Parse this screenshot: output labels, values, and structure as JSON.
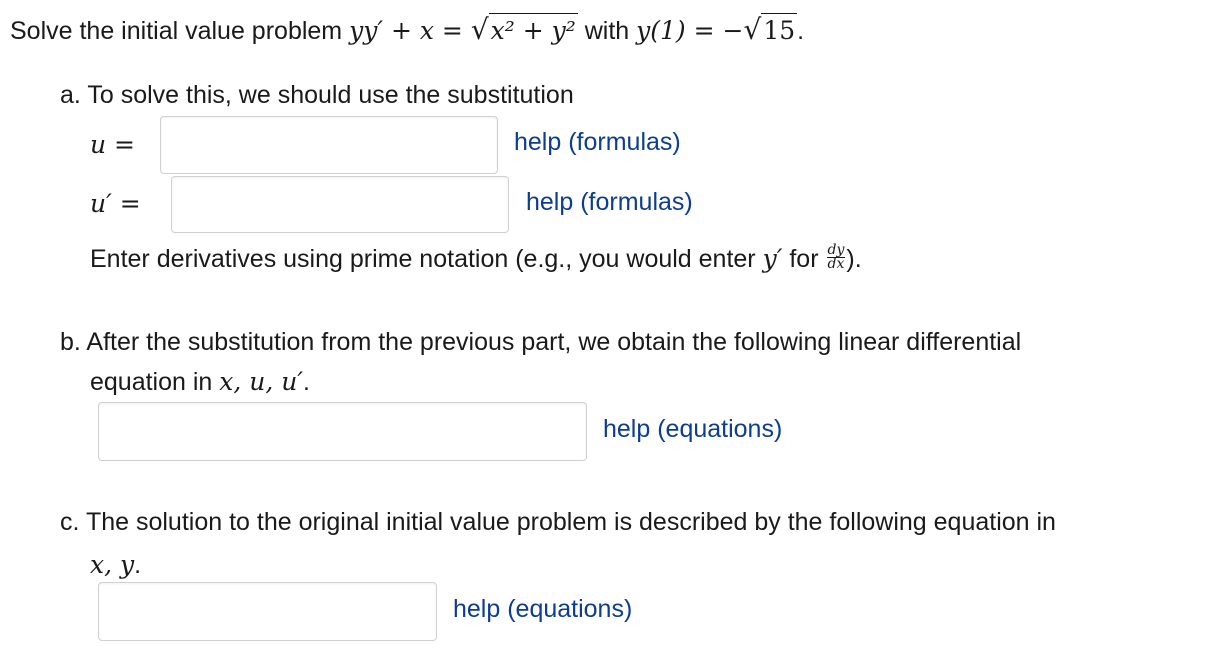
{
  "problem": {
    "intro": "Solve the initial value problem",
    "ode_lhs": "yy′ + x = ",
    "ode_rhs_sqrt": "x² + y²",
    "with_word": "with",
    "ic_lhs": "y(1) = −",
    "ic_sqrt": "15",
    "end_period": "."
  },
  "part_a": {
    "prompt": "a. To solve this, we should use the substitution",
    "u_label": "u =",
    "u_value": "",
    "u_help": "help (formulas)",
    "uprime_label": "u′ =",
    "uprime_value": "",
    "uprime_help": "help (formulas)",
    "note_prefix": "Enter derivatives using prime notation (e.g., you would enter",
    "note_yprime": "y′",
    "note_for": "for",
    "note_frac_num": "dy",
    "note_frac_den": "dx",
    "note_suffix": ")."
  },
  "part_b": {
    "prompt_line1": "b. After the substitution from the previous part, we obtain the following linear differential",
    "prompt_line2_text": "equation in",
    "prompt_line2_vars": "x, u, u′",
    "prompt_line2_end": ".",
    "answer_value": "",
    "help": "help (equations)"
  },
  "part_c": {
    "prompt_line1": "c. The solution to the original initial value problem is described by the following equation in",
    "prompt_line2_vars": "x, y",
    "prompt_line2_end": ".",
    "answer_value": "",
    "help": "help (equations)"
  },
  "colors": {
    "link": "#0d3d91",
    "input_border": "#d0d0d0",
    "text": "#1a1a1a"
  }
}
